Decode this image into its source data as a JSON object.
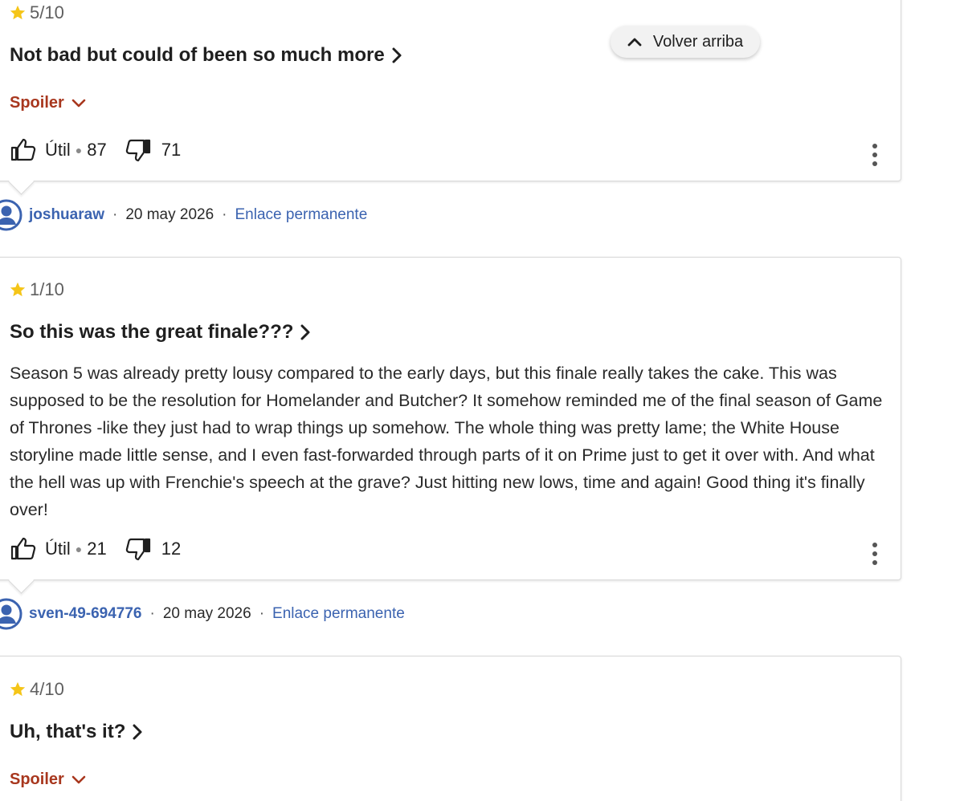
{
  "back_to_top": {
    "label": "Volver arriba"
  },
  "reviews": [
    {
      "rating": "5/10",
      "title": "Not bad but could of been so much more",
      "spoiler_label": "Spoiler",
      "helpful_label": "Útil",
      "helpful_count": "87",
      "unhelpful_count": "71"
    },
    {
      "author": "joshuaraw",
      "date": "20 may 2026",
      "permalink_label": "Enlace permanente",
      "rating": "1/10",
      "title": "So this was the great finale???",
      "body": "Season 5 was already pretty lousy compared to the early days, but this finale really takes the cake. This was supposed to be the resolution for Homelander and Butcher? It somehow reminded me of the final season of Game of Thrones -like they just had to wrap things up somehow. The whole thing was pretty lame; the White House storyline made little sense, and I even fast-forwarded through parts of it on Prime just to get it over with. And what the hell was up with Frenchie's speech at the grave? Just hitting new lows, time and again! Good thing it's finally over!",
      "helpful_label": "Útil",
      "helpful_count": "21",
      "unhelpful_count": "12"
    },
    {
      "author": "sven-49-694776",
      "date": "20 may 2026",
      "permalink_label": "Enlace permanente",
      "rating": "4/10",
      "title": "Uh, that's it?",
      "spoiler_label": "Spoiler"
    }
  ],
  "colors": {
    "star": "#f5c518",
    "link": "#3b63b0",
    "spoiler": "#a8371e"
  },
  "icons": [
    "star-icon",
    "chevron-right-icon",
    "chevron-down-icon",
    "thumbs-up-icon",
    "thumbs-down-icon",
    "more-vertical-icon",
    "avatar-icon",
    "chevron-up-icon"
  ]
}
